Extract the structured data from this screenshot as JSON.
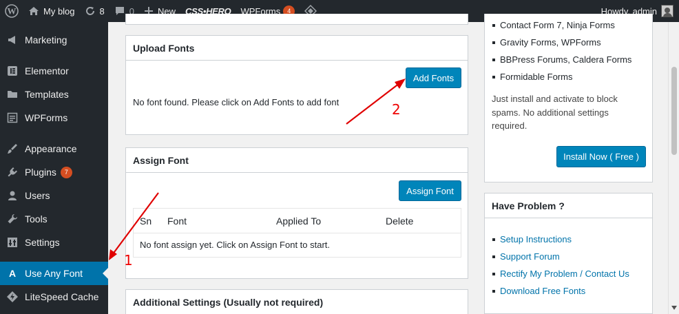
{
  "adminbar": {
    "site_name": "My blog",
    "updates_count": "8",
    "comments_count": "0",
    "new_label": "New",
    "csshero_label": "CSS•HERO",
    "wpforms_label": "WPForms",
    "wpforms_badge": "4",
    "greeting": "Howdy, admin"
  },
  "sidebar": {
    "items": [
      {
        "label": "Marketing",
        "icon": "megaphone-icon"
      },
      {
        "label": "Elementor",
        "icon": "elementor-icon"
      },
      {
        "label": "Templates",
        "icon": "folder-icon"
      },
      {
        "label": "WPForms",
        "icon": "form-icon"
      },
      {
        "label": "Appearance",
        "icon": "brush-icon"
      },
      {
        "label": "Plugins",
        "icon": "plug-icon",
        "badge": "7"
      },
      {
        "label": "Users",
        "icon": "user-icon"
      },
      {
        "label": "Tools",
        "icon": "wrench-icon"
      },
      {
        "label": "Settings",
        "icon": "settings-icon"
      },
      {
        "label": "Use Any Font",
        "icon": "font-a-icon",
        "current": true
      },
      {
        "label": "LiteSpeed Cache",
        "icon": "litespeed-icon"
      }
    ]
  },
  "upload_fonts": {
    "title": "Upload Fonts",
    "add_button": "Add Fonts",
    "empty_message": "No font found. Please click on Add Fonts to add font"
  },
  "assign_font": {
    "title": "Assign Font",
    "assign_button": "Assign Font",
    "columns": [
      "Sn",
      "Font",
      "Applied To",
      "Delete"
    ],
    "empty_message": "No font assign yet. Click on Assign Font to start."
  },
  "additional_settings": {
    "title": "Additional Settings (Usually not required)"
  },
  "spam_panel": {
    "items": [
      "Contact Form 7, Ninja Forms",
      "Gravity Forms, WPForms",
      "BBPress Forums, Caldera Forms",
      "Formidable Forms"
    ],
    "description": "Just install and activate to block spams. No additional settings required.",
    "install_button": "Install Now ( Free )"
  },
  "problem_panel": {
    "title": "Have Problem ?",
    "links": [
      "Setup Instructions",
      "Support Forum",
      "Rectify My Problem / Contact Us",
      "Download Free Fonts"
    ]
  },
  "annotations": {
    "step1": "1",
    "step2": "2",
    "color": "#e00000"
  },
  "colors": {
    "adminbar_bg": "#23282d",
    "accent": "#0073aa",
    "button": "#0085ba",
    "badge": "#d54e21"
  }
}
